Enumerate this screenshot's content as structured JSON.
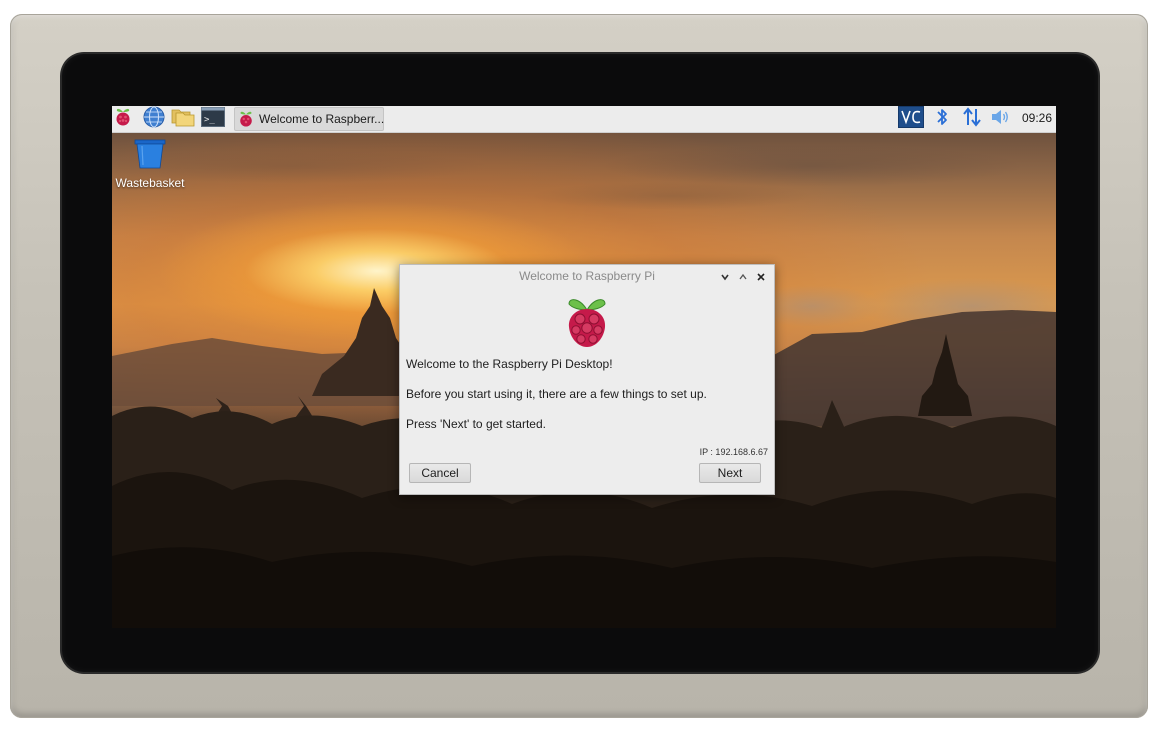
{
  "taskbar": {
    "task_welcome_label": "Welcome to Raspberr...",
    "clock": "09:26",
    "icons": [
      "raspberry-pi-menu-icon",
      "globe-browser-icon",
      "folders-icon",
      "terminal-icon",
      "vnc-icon",
      "bluetooth-icon",
      "network-arrows-icon",
      "speaker-volume-icon"
    ]
  },
  "desktop": {
    "wastebasket_label": "Wastebasket"
  },
  "dialog": {
    "title": "Welcome to Raspberry Pi",
    "line1": "Welcome to the Raspberry Pi Desktop!",
    "line2": "Before you start using it, there are a few things to set up.",
    "line3": "Press 'Next' to get started.",
    "ip": "IP : 192.168.6.67",
    "cancel_label": "Cancel",
    "next_label": "Next"
  },
  "colors": {
    "raspberry_red": "#c51a4a",
    "leaf_green": "#6cc04a",
    "vnc_blue": "#1f4e8c",
    "bluetooth_blue": "#2a6fd6"
  }
}
